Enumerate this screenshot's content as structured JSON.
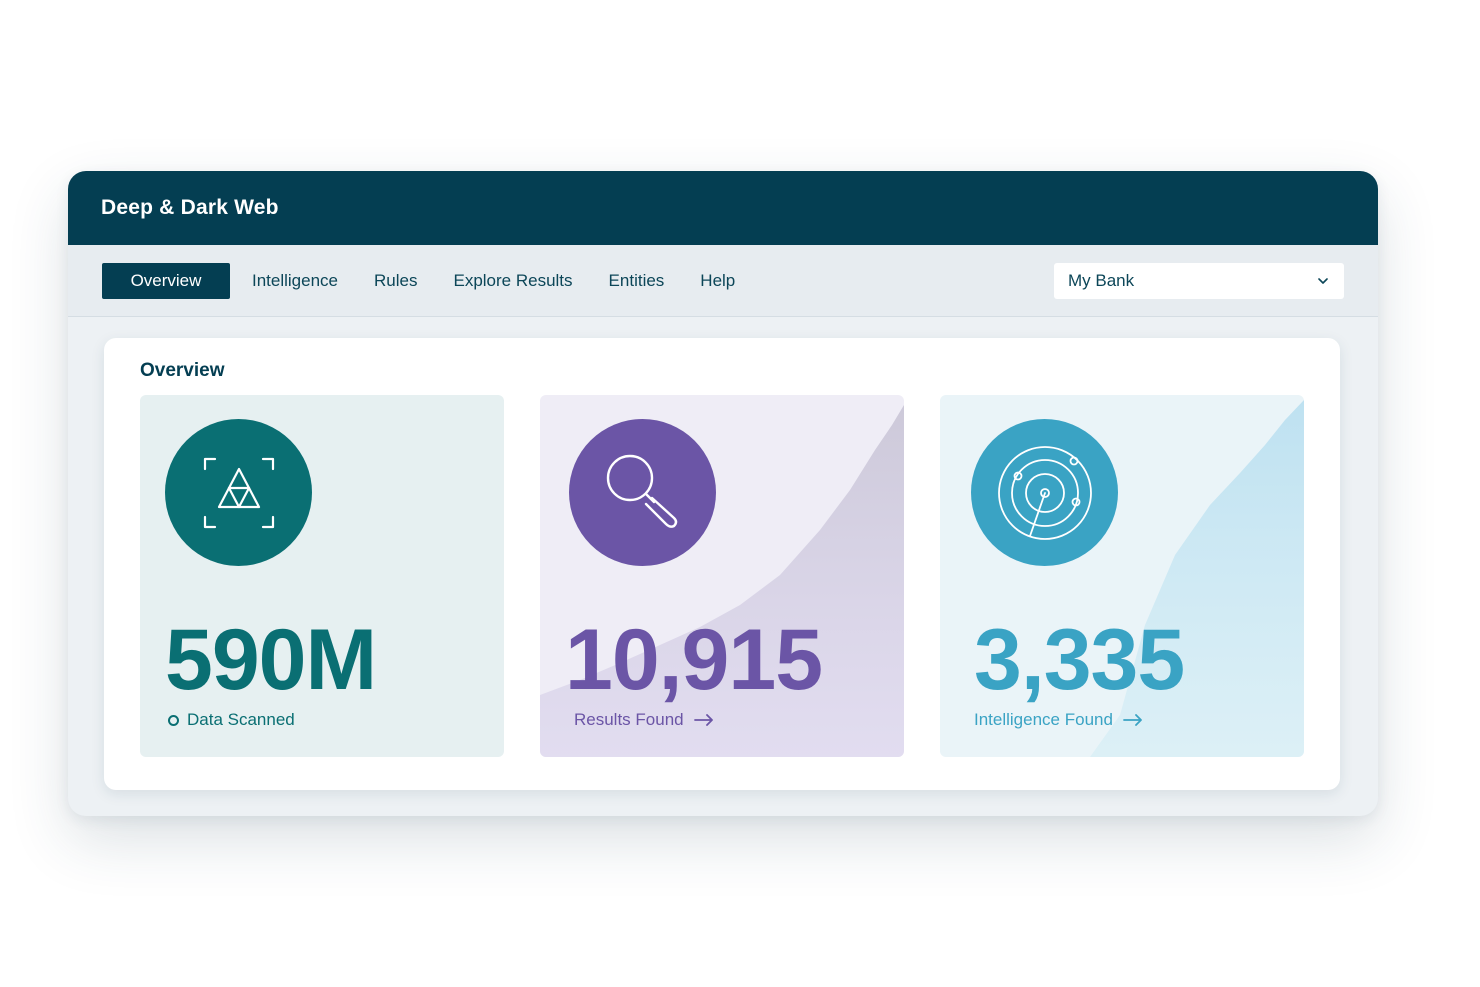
{
  "app": {
    "title": "Deep & Dark Web"
  },
  "nav": {
    "tabs": [
      {
        "label": "Overview",
        "active": true
      },
      {
        "label": "Intelligence",
        "active": false
      },
      {
        "label": "Rules",
        "active": false
      },
      {
        "label": "Explore Results",
        "active": false
      },
      {
        "label": "Entities",
        "active": false
      },
      {
        "label": "Help",
        "active": false
      }
    ],
    "org_select": {
      "value": "My Bank",
      "icon": "chevron-down-icon"
    }
  },
  "overview": {
    "title": "Overview",
    "cards": [
      {
        "value": "590M",
        "label": "Data Scanned",
        "icon": "triangle-scan-icon",
        "color": "#0a6f73"
      },
      {
        "value": "10,915",
        "label": "Results Found",
        "icon": "magnifier-icon",
        "color": "#6b55a6"
      },
      {
        "value": "3,335",
        "label": "Intelligence Found",
        "icon": "radar-icon",
        "color": "#3aa3c4"
      }
    ]
  },
  "colors": {
    "header": "#043e52",
    "active_tab": "#043e52",
    "teal": "#0a6f73",
    "purple": "#6b55a6",
    "blue": "#3aa3c4"
  }
}
